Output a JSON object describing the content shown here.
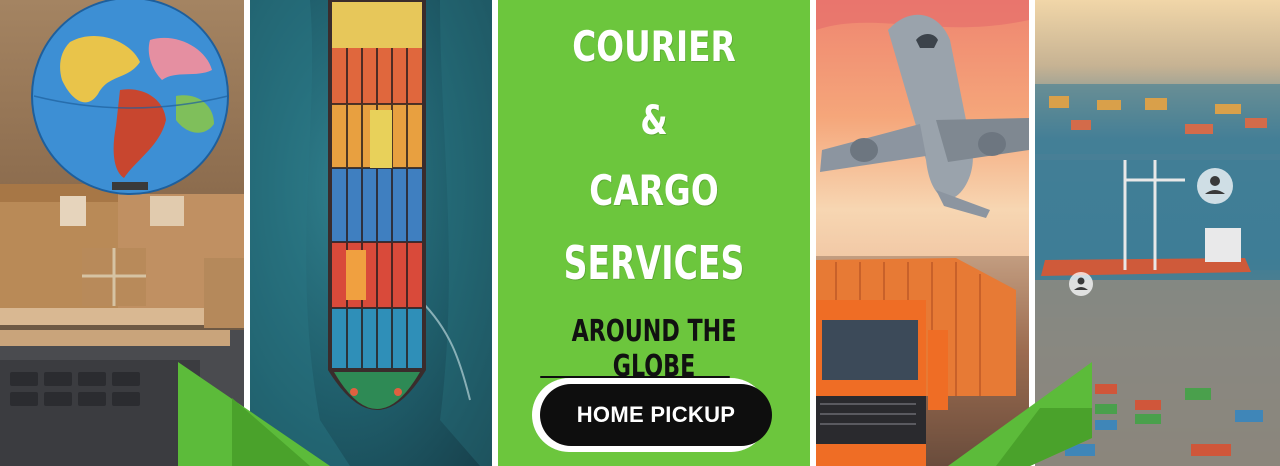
{
  "banner": {
    "headline_line1": "COURIER",
    "headline_line2": "&",
    "headline_line3": "CARGO",
    "headline_line4": "SERVICES",
    "subheadline": "AROUND THE GLOBE",
    "cta_label": "HOME PICKUP"
  },
  "colors": {
    "center_panel": "#6cc63d",
    "ribbon": "#5cbb3a",
    "cta_background": "#0e0e0e",
    "cta_text": "#ffffff"
  },
  "icons": [
    "globe-icon",
    "parcel-icon",
    "container-ship-icon",
    "airplane-icon",
    "truck-icon",
    "port-icon",
    "user-pin-icon"
  ]
}
